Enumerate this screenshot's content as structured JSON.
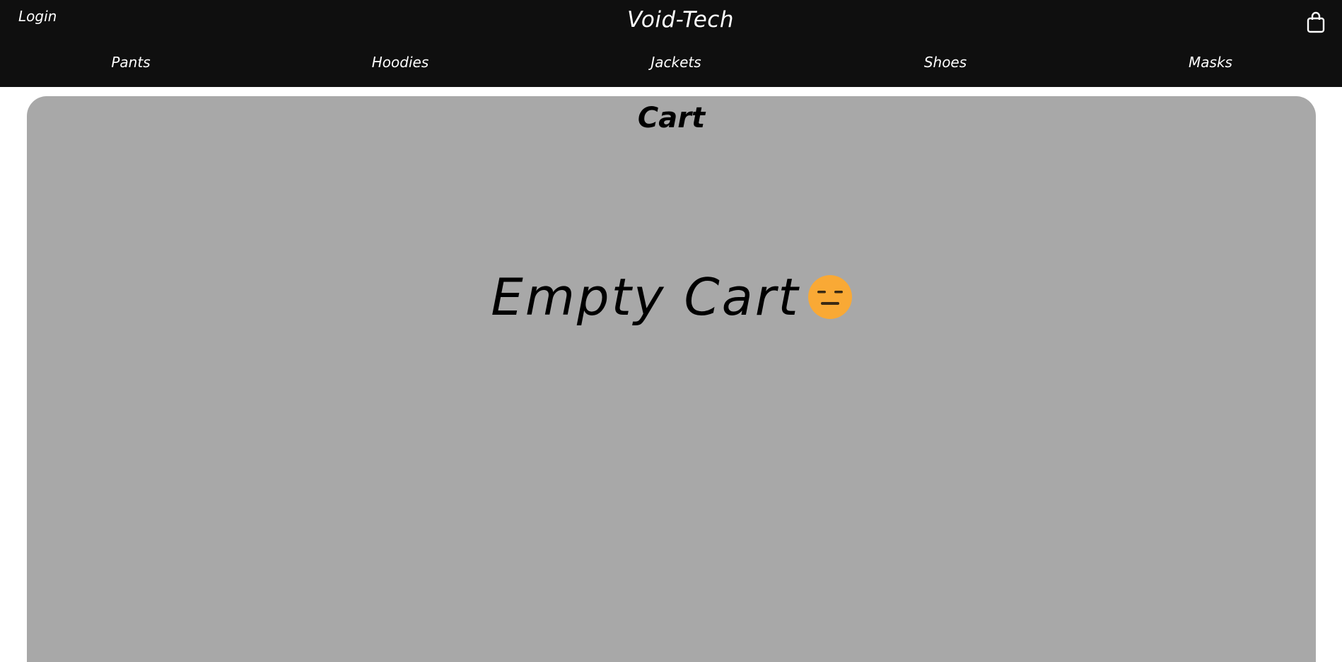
{
  "header": {
    "login_label": "Login",
    "brand_title": "Void-Tech",
    "cart_icon": "shopping-bag-icon"
  },
  "nav": {
    "items": [
      {
        "label": "Pants"
      },
      {
        "label": "Hoodies"
      },
      {
        "label": "Jackets"
      },
      {
        "label": "Shoes"
      },
      {
        "label": "Masks"
      }
    ]
  },
  "cart": {
    "heading": "Cart",
    "empty_message": "Empty Cart",
    "empty_icon": "expressionless-face-emoji"
  },
  "colors": {
    "header_bg": "#0f0f0f",
    "panel_bg": "#a8a8a8",
    "emoji_face": "#f9a935"
  }
}
